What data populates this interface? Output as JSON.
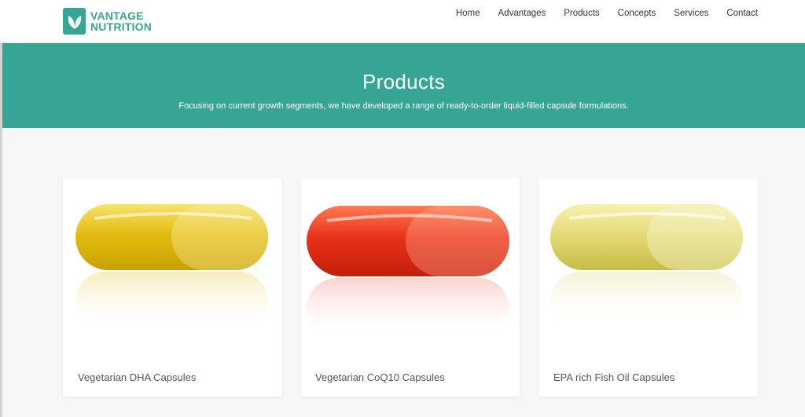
{
  "brand": {
    "line1": "VANTAGE",
    "line2": "NUTRITION",
    "color": "#37a593"
  },
  "nav": {
    "items": [
      "Home",
      "Advantages",
      "Products",
      "Concepts",
      "Services",
      "Contact"
    ]
  },
  "banner": {
    "title": "Products",
    "subtitle": "Focusing on current growth segments, we have developed a range of ready-to-order liquid-filled capsule formulations.",
    "color": "#37a593"
  },
  "products": [
    {
      "name": "Vegetarian DHA Capsules",
      "capsule_color": "#e6c21a"
    },
    {
      "name": "Vegetarian CoQ10 Capsules",
      "capsule_color": "#e8321a"
    },
    {
      "name": "EPA rich Fish Oil Capsules",
      "capsule_color": "#e4dc78"
    }
  ]
}
